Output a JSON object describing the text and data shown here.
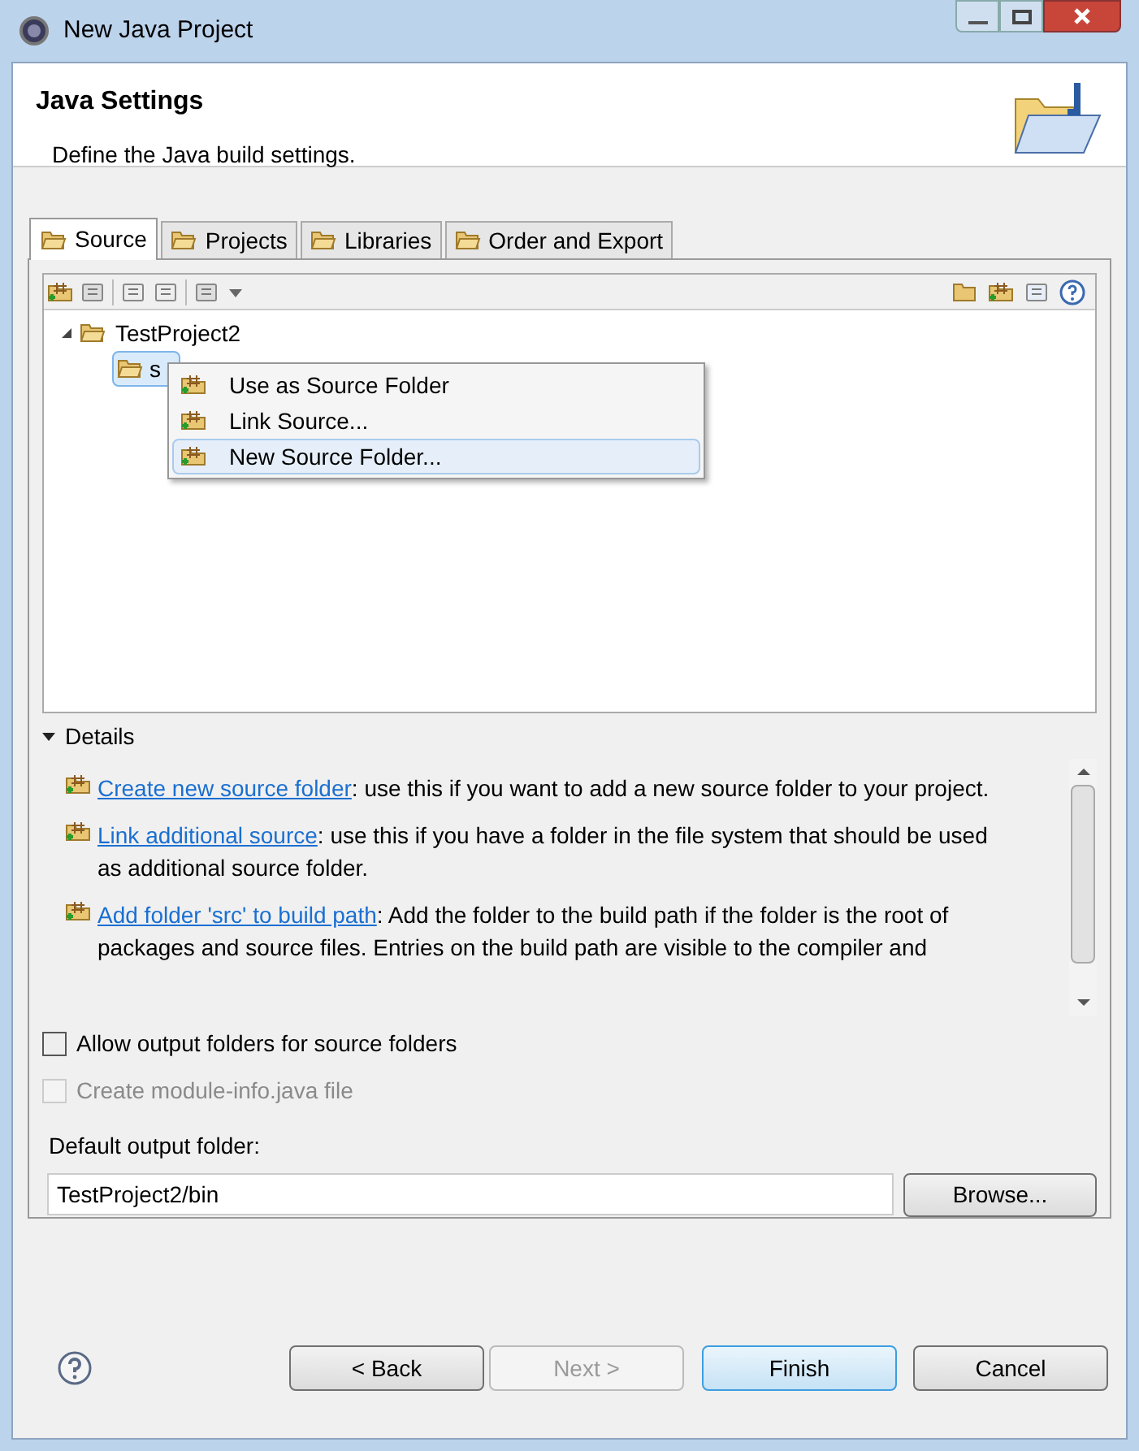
{
  "window": {
    "title": "New Java Project"
  },
  "header": {
    "title": "Java Settings",
    "description": "Define the Java build settings."
  },
  "tabs": [
    {
      "label": "Source",
      "selected": true
    },
    {
      "label": "Projects",
      "selected": false
    },
    {
      "label": "Libraries",
      "selected": false
    },
    {
      "label": "Order and Export",
      "selected": false
    }
  ],
  "tree": [
    {
      "label": "TestProject2",
      "expanded": true,
      "selected": false,
      "children": [
        {
          "label": "s",
          "selected": true
        }
      ]
    }
  ],
  "context_menu": [
    {
      "label": "Use as Source Folder",
      "selected": false
    },
    {
      "label": "Link Source...",
      "selected": false
    },
    {
      "label": "New Source Folder...",
      "selected": true
    }
  ],
  "details": {
    "title": "Details",
    "expanded": true,
    "items": [
      {
        "link": "Create new source folder",
        "text": ": use this if you want to add a new source folder to your project."
      },
      {
        "link": "Link additional source",
        "text": ": use this if you have a folder in the file system that should be used as additional source folder."
      },
      {
        "link": "Add folder 'src' to build path",
        "text": ": Add the folder to the build path if the folder is the root of packages and source files. Entries on the build path are visible to the compiler and"
      }
    ]
  },
  "options": [
    {
      "label": "Allow output folders for source folders",
      "checked": false,
      "disabled": false
    },
    {
      "label": "Create module-info.java file",
      "checked": false,
      "disabled": true
    }
  ],
  "output_folder": {
    "label": "Default output folder:",
    "value": "TestProject2/bin",
    "browse": "Browse..."
  },
  "buttons": [
    {
      "label": "< Back",
      "disabled": false,
      "default": false
    },
    {
      "label": "Next >",
      "disabled": true,
      "default": false
    },
    {
      "label": "Finish",
      "disabled": false,
      "default": true
    },
    {
      "label": "Cancel",
      "disabled": false,
      "default": false
    }
  ]
}
